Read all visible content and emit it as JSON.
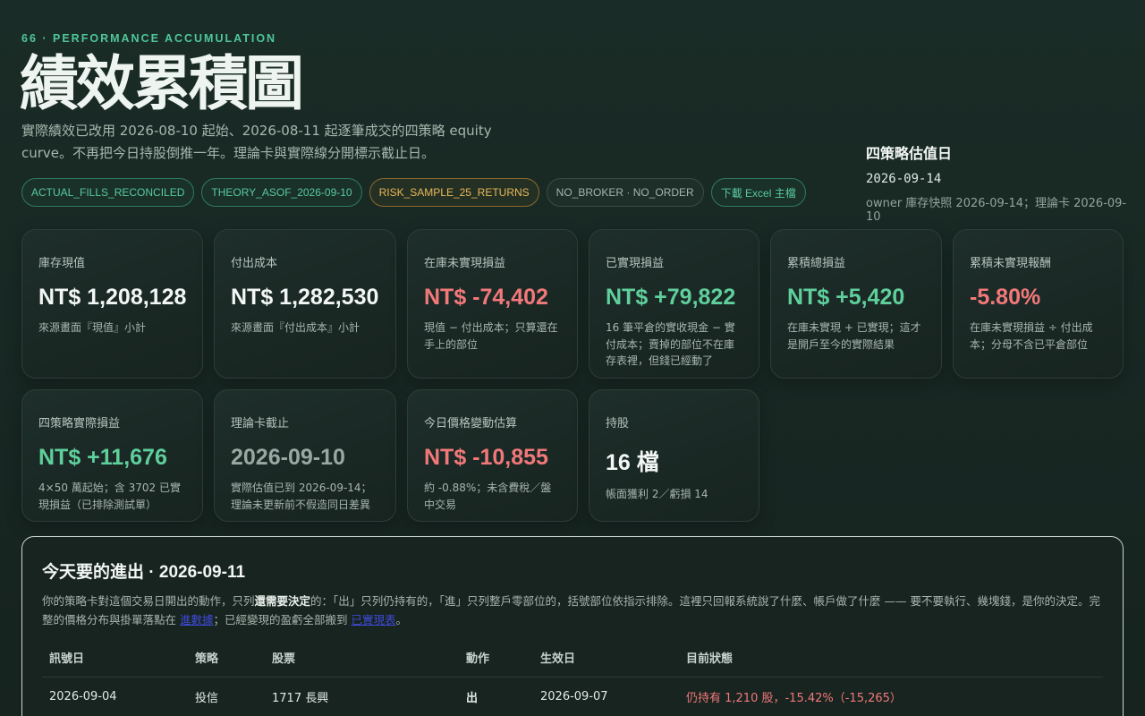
{
  "header": {
    "kicker": "66 · PERFORMANCE ACCUMULATION",
    "title": "績效累積圖",
    "subtitle": "實際績效已改用 2026-08-10 起始、2026-08-11 起逐筆成交的四策略 equity curve。不再把今日持股倒推一年。理論卡與實際線分開標示截止日。"
  },
  "chips": [
    {
      "label": "ACTUAL_FILLS_RECONCILED",
      "tone": "green"
    },
    {
      "label": "THEORY_ASOF_2026-09-10",
      "tone": "green"
    },
    {
      "label": "RISK_SAMPLE_25_RETURNS",
      "tone": "amber"
    },
    {
      "label": "NO_BROKER · NO_ORDER",
      "tone": "gray"
    },
    {
      "label": "下載 Excel 主檔",
      "tone": "link"
    }
  ],
  "asof": {
    "label": "四策略估值日",
    "date": "2026-09-14",
    "note": "owner 庫存快照 2026-09-14；理論卡 2026-09-10"
  },
  "cards": [
    {
      "label": "庫存現值",
      "value": "NT$ 1,208,128",
      "note": "來源畫面『現值』小計",
      "tone": "white"
    },
    {
      "label": "付出成本",
      "value": "NT$ 1,282,530",
      "note": "來源畫面『付出成本』小計",
      "tone": "white"
    },
    {
      "label": "在庫未實現損益",
      "value": "NT$ -74,402",
      "note": "現值 − 付出成本；只算還在手上的部位",
      "tone": "red"
    },
    {
      "label": "已實現損益",
      "value": "NT$ +79,822",
      "note": "16 筆平倉的實收現金 − 實付成本；賣掉的部位不在庫存表裡，但錢已經動了",
      "tone": "green"
    },
    {
      "label": "累積總損益",
      "value": "NT$ +5,420",
      "note": "在庫未實現 + 已實現；這才是開戶至今的實際結果",
      "tone": "green"
    },
    {
      "label": "累積未實現報酬",
      "value": "-5.80%",
      "note": "在庫未實現損益 ÷ 付出成本；分母不含已平倉部位",
      "tone": "red"
    },
    {
      "label": "四策略實際損益",
      "value": "NT$ +11,676",
      "note": "4×50 萬起始；含 3702 已實現損益（已排除測試單）",
      "tone": "green"
    },
    {
      "label": "理論卡截止",
      "value": "2026-09-10",
      "note": "實際估值已到 2026-09-14；理論未更新前不假造同日差異",
      "tone": "gray"
    },
    {
      "label": "今日價格變動估算",
      "value": "NT$ -10,855",
      "note": "約 -0.88%；未含費稅／盤中交易",
      "tone": "red"
    },
    {
      "label": "持股",
      "value": "16 檔",
      "note": "帳面獲利 2／虧損 14",
      "tone": "white"
    }
  ],
  "panel": {
    "title": "今天要的進出 · 2026-09-11",
    "desc_before": "你的策略卡對這個交易日開出的動作，只列",
    "desc_bold": "還需要決定",
    "desc_mid": "的：「出」只列仍持有的，「進」只列整戶零部位的，括號部位依指示排除。這裡只回報系統說了什麼、帳戶做了什麼 —— 要不要執行、幾塊錢，是你的決定。完整的價格分布與掛單落點在 ",
    "link1": "進數據",
    "desc_mid2": "；已經變現的盈虧全部搬到 ",
    "link2": "已實現表",
    "desc_end": "。",
    "columns": [
      "訊號日",
      "策略",
      "股票",
      "動作",
      "生效日",
      "目前狀態"
    ],
    "rows": [
      [
        "2026-09-04",
        "投信",
        "1717 長興",
        "出",
        "2026-09-07",
        "仍持有 1,210 股，-15.42%（-15,265）"
      ]
    ]
  }
}
